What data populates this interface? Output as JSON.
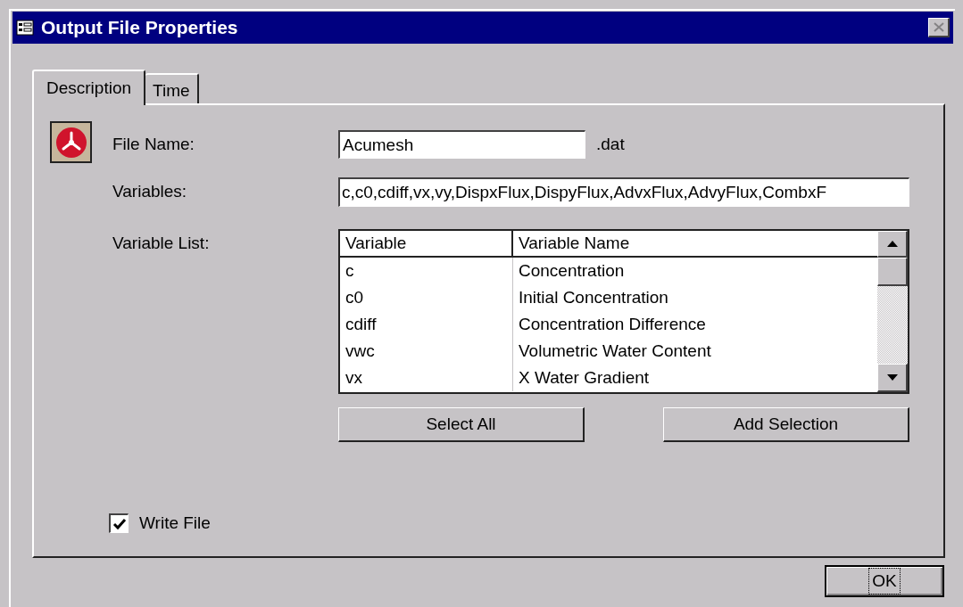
{
  "window": {
    "title": "Output File Properties"
  },
  "tabs": [
    {
      "label": "Description",
      "selected": true
    },
    {
      "label": "Time",
      "selected": false
    }
  ],
  "file_name": {
    "label": "File Name:",
    "value": "Acumesh",
    "suffix": ".dat"
  },
  "variables": {
    "label": "Variables:",
    "value": "c,c0,cdiff,vx,vy,DispxFlux,DispyFlux,AdvxFlux,AdvyFlux,CombxF"
  },
  "variable_list": {
    "label": "Variable List:",
    "columns": [
      "Variable",
      "Variable Name"
    ],
    "rows": [
      [
        "c",
        "Concentration"
      ],
      [
        "c0",
        "Initial Concentration"
      ],
      [
        "cdiff",
        "Concentration Difference"
      ],
      [
        "vwc",
        "Volumetric Water Content"
      ],
      [
        "vx",
        "X Water Gradient"
      ]
    ]
  },
  "buttons": [
    {
      "label": "Select All"
    },
    {
      "label": "Add Selection"
    }
  ],
  "write_file": {
    "label": "Write File",
    "checked": true
  },
  "ok_button": {
    "label": "OK",
    "focused": true
  }
}
